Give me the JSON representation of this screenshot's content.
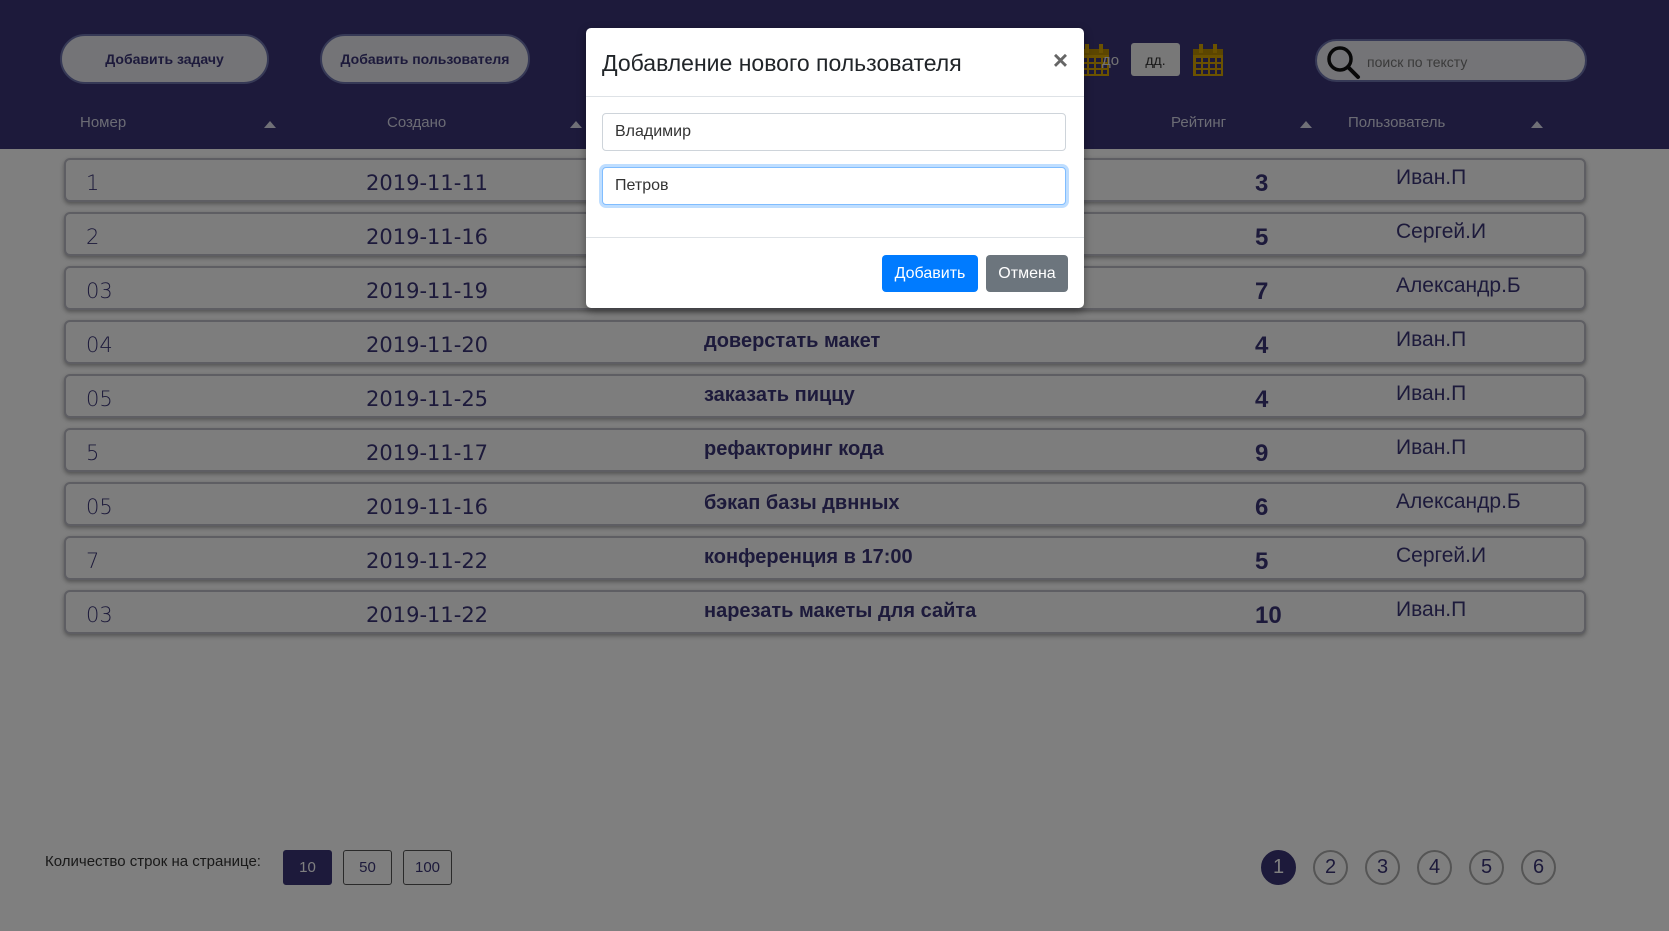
{
  "toolbar": {
    "add_task_label": "Добавить задачу",
    "add_user_label": "Добавить пользователя",
    "date_to_label": "до",
    "date_placeholder": "дд.",
    "search_placeholder": "поиск по тексту"
  },
  "columns": [
    "Номер",
    "Создано",
    "Рейтинг",
    "Пользователь"
  ],
  "rows": [
    {
      "num": "1",
      "date": "2019-11-11",
      "task": "",
      "rating": "3",
      "user": "Иван.П"
    },
    {
      "num": "2",
      "date": "2019-11-16",
      "task": "",
      "rating": "5",
      "user": "Сергей.И"
    },
    {
      "num": "03",
      "date": "2019-11-19",
      "task": "",
      "rating": "7",
      "user": "Александр.Б"
    },
    {
      "num": "04",
      "date": "2019-11-20",
      "task": "доверстать макет",
      "rating": "4",
      "user": "Иван.П"
    },
    {
      "num": "05",
      "date": "2019-11-25",
      "task": "заказать пиццу",
      "rating": "4",
      "user": "Иван.П"
    },
    {
      "num": "5",
      "date": "2019-11-17",
      "task": "рефакторинг кода",
      "rating": "9",
      "user": "Иван.П"
    },
    {
      "num": "05",
      "date": "2019-11-16",
      "task": "бэкап базы двнных",
      "rating": "6",
      "user": "Александр.Б"
    },
    {
      "num": "7",
      "date": "2019-11-22",
      "task": "конференция в 17:00",
      "rating": "5",
      "user": "Сергей.И"
    },
    {
      "num": "03",
      "date": "2019-11-22",
      "task": "нарезать макеты для сайта",
      "rating": "10",
      "user": "Иван.П"
    }
  ],
  "footer": {
    "rows_label": "Количество строк на странице:",
    "sizes": [
      "10",
      "50",
      "100"
    ],
    "active_size": "10",
    "pages": [
      "1",
      "2",
      "3",
      "4",
      "5",
      "6"
    ],
    "active_page": "1"
  },
  "modal": {
    "title": "Добавление нового пользователя",
    "close_symbol": "×",
    "first_name": "Владимир",
    "last_name": "Петров",
    "submit_label": "Добавить",
    "cancel_label": "Отмена"
  },
  "colors": {
    "header": "#3a3577",
    "accent_gold": "#d6a500",
    "primary": "#007bff",
    "secondary": "#6c757d"
  }
}
